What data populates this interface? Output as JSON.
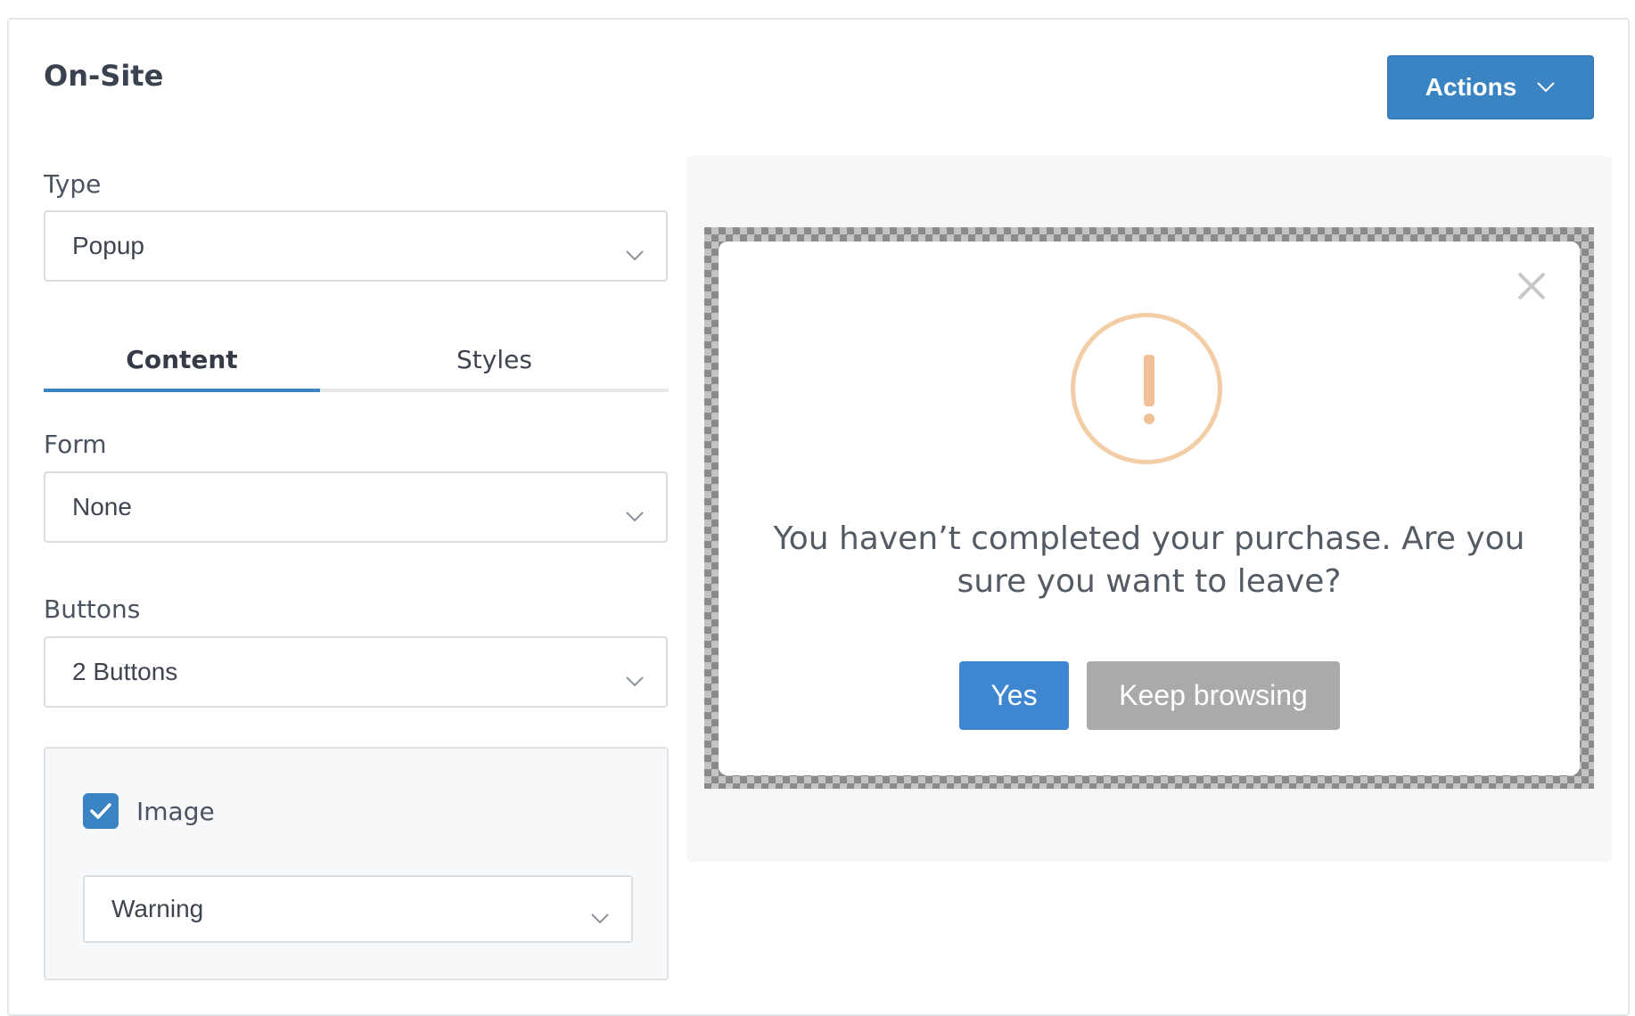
{
  "header": {
    "title": "On-Site",
    "actions_label": "Actions"
  },
  "type_field": {
    "label": "Type",
    "value": "Popup"
  },
  "tabs": [
    {
      "label": "Content",
      "active": true
    },
    {
      "label": "Styles",
      "active": false
    }
  ],
  "form_field": {
    "label": "Form",
    "value": "None"
  },
  "buttons_field": {
    "label": "Buttons",
    "value": "2 Buttons"
  },
  "image_option": {
    "label": "Image",
    "checked": true,
    "value": "Warning"
  },
  "preview": {
    "message": "You haven’t completed your purchase. Are you sure you want to leave?",
    "yes_label": "Yes",
    "keep_label": "Keep browsing",
    "icon": "warning-exclamation-icon"
  },
  "colors": {
    "accent": "#3b84c4",
    "warning": "#f2c096",
    "secondary_button": "#aaaaaa"
  }
}
